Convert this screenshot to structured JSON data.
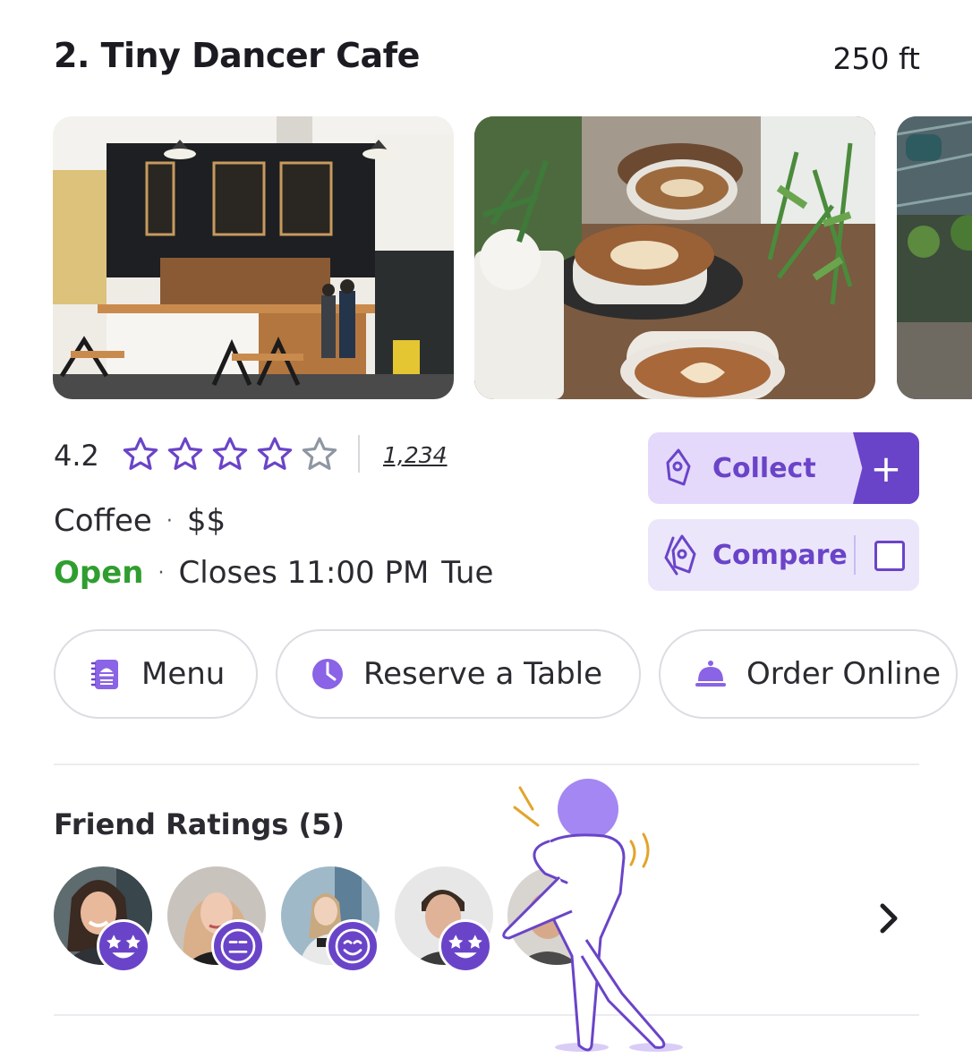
{
  "listing": {
    "title": "2. Tiny Dancer Cafe",
    "distance": "250 ft",
    "rating": "4.2",
    "rating_value": 4.2,
    "stars_filled": 4,
    "stars_total": 5,
    "review_count": "1,234",
    "category": "Coffee",
    "price": "$$",
    "separator": "·",
    "status": "Open",
    "closes": "Closes 11:00 PM",
    "day": "Tue"
  },
  "photos": [
    {
      "subject": "cafe-interior"
    },
    {
      "subject": "latte-cups"
    },
    {
      "subject": "greenhouse-cafe"
    }
  ],
  "actions": {
    "collect_label": "Collect",
    "collect_plus": "+",
    "compare_label": "Compare"
  },
  "quick_actions": [
    {
      "label": "Menu",
      "icon": "menu-book-icon"
    },
    {
      "label": "Reserve a Table",
      "icon": "clock-icon"
    },
    {
      "label": "Order Online",
      "icon": "service-bell-icon"
    }
  ],
  "friends": {
    "title": "Friend Ratings (5)",
    "avatars": [
      {
        "reaction": "star-struck-emoji-icon"
      },
      {
        "reaction": "neutral-face-emoji-icon"
      },
      {
        "reaction": "smiling-face-emoji-icon"
      },
      {
        "reaction": "star-struck-emoji-icon"
      },
      {
        "reaction": "partial-avatar"
      }
    ],
    "next_icon": "chevron-right-icon"
  },
  "colors": {
    "brand": "#6a44c8",
    "brand_light": "#e4d9fb",
    "open_green": "#2f9e2f",
    "text": "#2a2a30"
  }
}
